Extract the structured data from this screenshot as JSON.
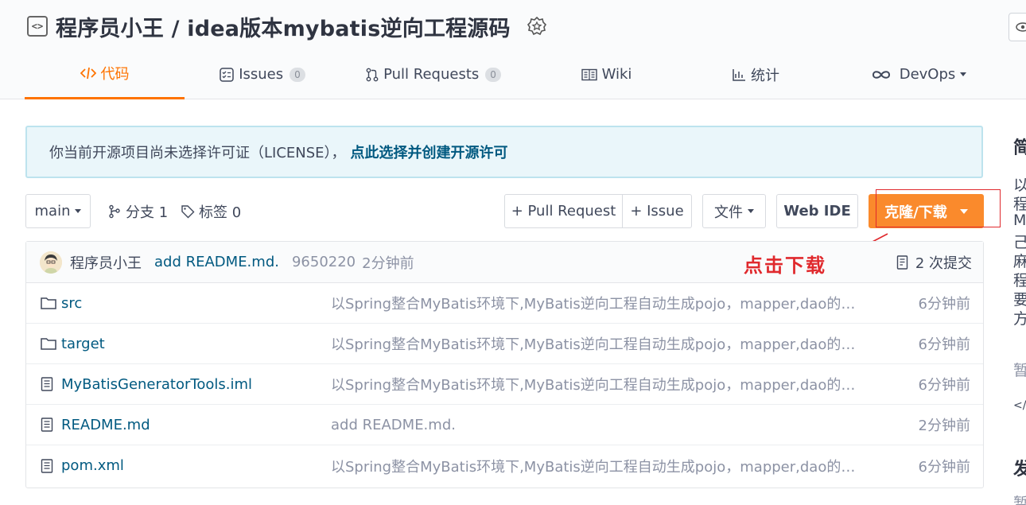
{
  "repo": {
    "title": "程序员小王 / idea版本mybatis逆向工程源码"
  },
  "tabs": [
    {
      "label": "代码",
      "icon": "code-icon"
    },
    {
      "label": "Issues",
      "count": "0",
      "icon": "issues-icon"
    },
    {
      "label": "Pull Requests",
      "count": "0",
      "icon": "pull-request-icon"
    },
    {
      "label": "Wiki",
      "icon": "wiki-icon"
    },
    {
      "label": "统计",
      "icon": "stats-icon"
    },
    {
      "label": "DevOps",
      "icon": "devops-icon"
    }
  ],
  "banner": {
    "text": "你当前开源项目尚未选择许可证（LICENSE），",
    "link": "点此选择并创建开源许可"
  },
  "toolbar": {
    "branch": "main",
    "branches": "分支 1",
    "tags": "标签 0",
    "pull_request": "+ Pull Request",
    "issue": "+ Issue",
    "files": "文件",
    "web_ide": "Web IDE",
    "clone": "克隆/下载"
  },
  "commit": {
    "author": "程序员小王",
    "message": "add README.md.",
    "hash": "9650220",
    "time": "2分钟前",
    "count": "2 次提交",
    "annotation": "点击下载"
  },
  "files": [
    {
      "name": "src",
      "type": "folder",
      "message": "以Spring整合MyBatis环境下,MyBatis逆向工程自动生成pojo，mapper,dao的J...",
      "time": "6分钟前"
    },
    {
      "name": "target",
      "type": "folder",
      "message": "以Spring整合MyBatis环境下,MyBatis逆向工程自动生成pojo，mapper,dao的J...",
      "time": "6分钟前"
    },
    {
      "name": "MyBatisGeneratorTools.iml",
      "type": "file",
      "message": "以Spring整合MyBatis环境下,MyBatis逆向工程自动生成pojo，mapper,dao的J...",
      "time": "6分钟前"
    },
    {
      "name": "README.md",
      "type": "file",
      "message": "add README.md.",
      "time": "2分钟前"
    },
    {
      "name": "pom.xml",
      "type": "file",
      "message": "以Spring整合MyBatis环境下,MyBatis逆向工程自动生成pojo，mapper,dao的J...",
      "time": "6分钟前"
    }
  ],
  "sidebar": {
    "intro_heading": "简",
    "intro_lines": [
      "以",
      "程",
      "M",
      "己",
      "麻",
      "程",
      "要",
      "方"
    ],
    "empty": "暂",
    "code_link": "</>",
    "release_heading": "发",
    "release_empty": "暂"
  },
  "colors": {
    "accent": "#fe7300",
    "clone_button": "#fa8a2c",
    "link": "#005980",
    "annotation": "#e0292d"
  }
}
